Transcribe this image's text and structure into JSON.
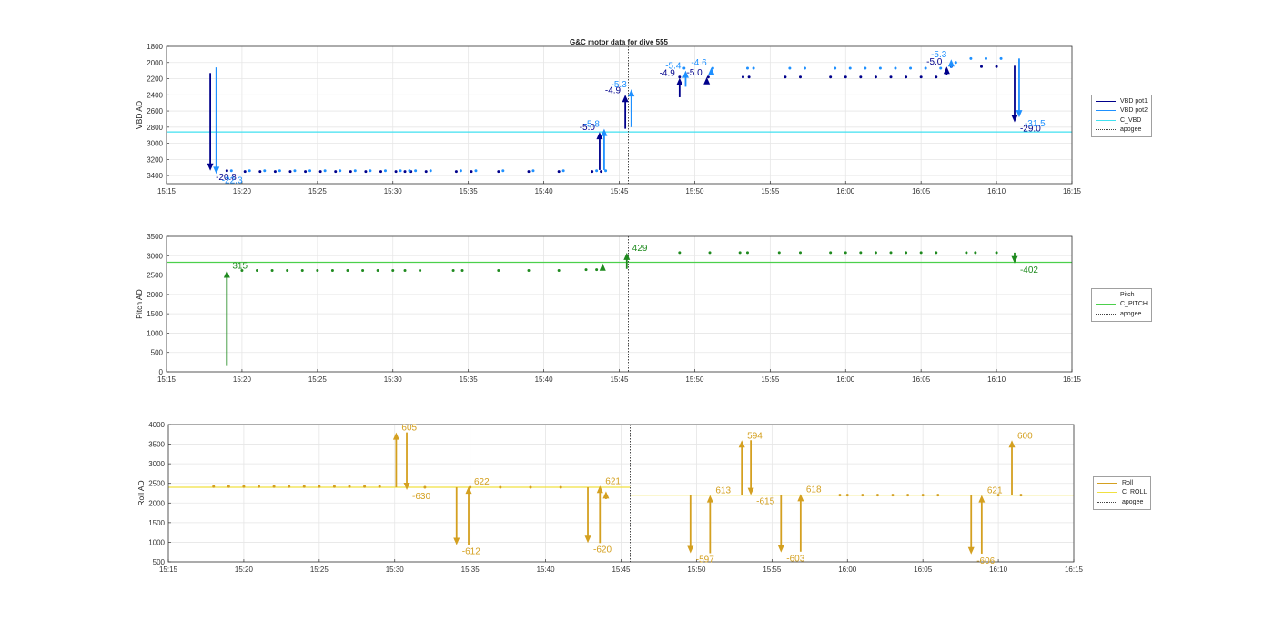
{
  "figure_title": "G&C motor data for dive 555",
  "chart_data": [
    {
      "type": "scatter",
      "title": "G&C motor data for dive 555",
      "xlabel": "",
      "ylabel": "VBD AD",
      "x_ticks": [
        "15:15",
        "15:20",
        "15:25",
        "15:30",
        "15:35",
        "15:40",
        "15:45",
        "15:50",
        "15:55",
        "16:00",
        "16:05",
        "16:10",
        "16:15"
      ],
      "x_range": [
        "15:15",
        "16:15"
      ],
      "ylim": [
        1800,
        3500
      ],
      "y_reversed": true,
      "y_ticks": [
        1800,
        2000,
        2200,
        2400,
        2600,
        2800,
        3000,
        3200,
        3400
      ],
      "grid": true,
      "legend": [
        {
          "label": "VBD pot1",
          "color": "#00008b",
          "style": "solid"
        },
        {
          "label": "VBD pot2",
          "color": "#1e90ff",
          "style": "solid"
        },
        {
          "label": "C_VBD",
          "color": "#40e0f0",
          "style": "solid"
        },
        {
          "label": "apogee",
          "color": "#444444",
          "style": "dotted"
        }
      ],
      "legend_placement": "outside-right",
      "reference_lines": [
        {
          "name": "C_VBD",
          "y": 2860,
          "color": "#40e0f0"
        }
      ],
      "apogee_time": "15:45.6",
      "series": [
        {
          "name": "VBD pot1",
          "color": "#00008b",
          "x": [
            "15:19.0",
            "15:20.2",
            "15:21.2",
            "15:22.2",
            "15:23.2",
            "15:24.2",
            "15:25.2",
            "15:26.2",
            "15:27.2",
            "15:28.2",
            "15:29.2",
            "15:30.2",
            "15:30.8",
            "15:31.2",
            "15:32.2",
            "15:34.2",
            "15:35.2",
            "15:37.0",
            "15:39.0",
            "15:41.0",
            "15:43.2",
            "15:43.8",
            "15:49.0",
            "15:50.9",
            "15:53.2",
            "15:53.6",
            "15:56.0",
            "15:57.0",
            "15:59.0",
            "16:00.0",
            "16:01.0",
            "16:02.0",
            "16:03.0",
            "16:04.0",
            "16:05.0",
            "16:06.0",
            "16:07.0",
            "16:09.0",
            "16:10.0"
          ],
          "y": [
            3340,
            3350,
            3350,
            3350,
            3350,
            3350,
            3350,
            3350,
            3350,
            3350,
            3350,
            3350,
            3350,
            3350,
            3350,
            3350,
            3350,
            3350,
            3350,
            3350,
            3350,
            3350,
            2180,
            2180,
            2180,
            2180,
            2180,
            2180,
            2180,
            2180,
            2180,
            2180,
            2180,
            2180,
            2180,
            2180,
            2050,
            2050,
            2050
          ]
        },
        {
          "name": "VBD pot2",
          "color": "#1e90ff",
          "x": [
            "15:19.3",
            "15:20.5",
            "15:21.5",
            "15:22.5",
            "15:23.5",
            "15:24.5",
            "15:25.5",
            "15:26.5",
            "15:27.5",
            "15:28.5",
            "15:29.5",
            "15:30.5",
            "15:31.1",
            "15:31.5",
            "15:32.5",
            "15:34.5",
            "15:35.5",
            "15:37.3",
            "15:39.3",
            "15:41.3",
            "15:43.5",
            "15:44.1",
            "15:49.3",
            "15:51.2",
            "15:53.5",
            "15:53.9",
            "15:56.3",
            "15:57.3",
            "15:59.3",
            "16:00.3",
            "16:01.3",
            "16:02.3",
            "16:03.3",
            "16:04.3",
            "16:05.3",
            "16:06.3",
            "16:07.3",
            "16:08.3",
            "16:09.3",
            "16:10.3"
          ],
          "y": [
            3340,
            3340,
            3340,
            3340,
            3340,
            3340,
            3340,
            3340,
            3340,
            3340,
            3340,
            3340,
            3340,
            3340,
            3340,
            3340,
            3340,
            3340,
            3340,
            3340,
            3340,
            3340,
            2070,
            2070,
            2070,
            2070,
            2070,
            2070,
            2070,
            2070,
            2070,
            2070,
            2070,
            2070,
            2070,
            2070,
            2000,
            1950,
            1950,
            1950
          ]
        }
      ],
      "events": [
        {
          "x": "15:17.9",
          "y_from": 2130,
          "y_to": 3340,
          "label": "-20.8",
          "color": "#00008b"
        },
        {
          "x": "15:18.3",
          "y_from": 2060,
          "y_to": 3380,
          "label": "-22.3",
          "color": "#1e90ff"
        },
        {
          "x": "15:43.7",
          "y_from": 3330,
          "y_to": 2860,
          "label": "-5.0",
          "color": "#00008b"
        },
        {
          "x": "15:44.0",
          "y_from": 3330,
          "y_to": 2820,
          "label": "-5.8",
          "color": "#1e90ff"
        },
        {
          "x": "15:45.4",
          "y_from": 2820,
          "y_to": 2400,
          "label": "-4.9",
          "color": "#00008b"
        },
        {
          "x": "15:45.8",
          "y_from": 2800,
          "y_to": 2330,
          "label": "-5.3",
          "color": "#1e90ff"
        },
        {
          "x": "15:49.0",
          "y_from": 2430,
          "y_to": 2190,
          "label": "-4.9",
          "color": "#00008b"
        },
        {
          "x": "15:49.4",
          "y_from": 2300,
          "y_to": 2100,
          "label": "-5.4",
          "color": "#1e90ff"
        },
        {
          "x": "15:50.8",
          "y_from": 2240,
          "y_to": 2180,
          "label": "-5.0",
          "color": "#00008b"
        },
        {
          "x": "15:51.1",
          "y_from": 2140,
          "y_to": 2060,
          "label": "-4.6",
          "color": "#1e90ff"
        },
        {
          "x": "16:06.7",
          "y_from": 2160,
          "y_to": 2050,
          "label": "-5.0",
          "color": "#00008b"
        },
        {
          "x": "16:07.0",
          "y_from": 2070,
          "y_to": 1960,
          "label": "-5.3",
          "color": "#1e90ff"
        },
        {
          "x": "16:11.2",
          "y_from": 2040,
          "y_to": 2740,
          "label": "-29.0",
          "color": "#00008b"
        },
        {
          "x": "16:11.5",
          "y_from": 1950,
          "y_to": 2680,
          "label": "-31.5",
          "color": "#1e90ff"
        }
      ]
    },
    {
      "type": "scatter",
      "title": "",
      "xlabel": "",
      "ylabel": "Pitch AD",
      "x_ticks": [
        "15:15",
        "15:20",
        "15:25",
        "15:30",
        "15:35",
        "15:40",
        "15:45",
        "15:50",
        "15:55",
        "16:00",
        "16:05",
        "16:10",
        "16:15"
      ],
      "x_range": [
        "15:15",
        "16:15"
      ],
      "ylim": [
        0,
        3500
      ],
      "y_reversed": false,
      "y_ticks": [
        0,
        500,
        1000,
        1500,
        2000,
        2500,
        3000,
        3500
      ],
      "grid": true,
      "legend": [
        {
          "label": "Pitch",
          "color": "#1f8a1f",
          "style": "solid"
        },
        {
          "label": "C_PITCH",
          "color": "#4cd04c",
          "style": "solid"
        },
        {
          "label": "apogee",
          "color": "#444444",
          "style": "dotted"
        }
      ],
      "legend_placement": "outside-right",
      "reference_lines": [
        {
          "name": "C_PITCH",
          "y": 2830,
          "color": "#4cd04c"
        }
      ],
      "apogee_time": "15:45.6",
      "series": [
        {
          "name": "Pitch",
          "color": "#1f8a1f",
          "x": [
            "15:20.0",
            "15:21.0",
            "15:22.0",
            "15:23.0",
            "15:24.0",
            "15:25.0",
            "15:26.0",
            "15:27.0",
            "15:28.0",
            "15:29.0",
            "15:30.0",
            "15:30.8",
            "15:31.8",
            "15:34.0",
            "15:34.6",
            "15:37.0",
            "15:39.0",
            "15:41.0",
            "15:42.8",
            "15:43.5",
            "15:49.0",
            "15:51.0",
            "15:53.0",
            "15:53.5",
            "15:55.6",
            "15:57.0",
            "15:59.0",
            "16:00.0",
            "16:01.0",
            "16:02.0",
            "16:03.0",
            "16:04.0",
            "16:05.0",
            "16:06.0",
            "16:08.0",
            "16:08.6",
            "16:10.0"
          ],
          "y": [
            2620,
            2620,
            2620,
            2620,
            2620,
            2620,
            2620,
            2620,
            2620,
            2620,
            2620,
            2620,
            2620,
            2620,
            2620,
            2620,
            2620,
            2620,
            2640,
            2640,
            3080,
            3080,
            3080,
            3080,
            3080,
            3080,
            3080,
            3080,
            3080,
            3080,
            3080,
            3080,
            3080,
            3080,
            3080,
            3080,
            3080
          ]
        }
      ],
      "events": [
        {
          "x": "15:19.0",
          "y_from": 150,
          "y_to": 2620,
          "label": "315",
          "color": "#1f8a1f"
        },
        {
          "x": "15:43.9",
          "y_from": 2640,
          "y_to": 2800,
          "label": "",
          "color": "#1f8a1f"
        },
        {
          "x": "15:45.5",
          "y_from": 2660,
          "y_to": 3080,
          "label": "429",
          "color": "#1f8a1f"
        },
        {
          "x": "16:11.2",
          "y_from": 3080,
          "y_to": 2800,
          "label": "-402",
          "color": "#1f8a1f"
        }
      ]
    },
    {
      "type": "scatter",
      "title": "",
      "xlabel": "",
      "ylabel": "Roll AD",
      "x_ticks": [
        "15:15",
        "15:20",
        "15:25",
        "15:30",
        "15:35",
        "15:40",
        "15:45",
        "15:50",
        "15:55",
        "16:00",
        "16:05",
        "16:10",
        "16:15"
      ],
      "x_range": [
        "15:15",
        "16:15"
      ],
      "ylim": [
        500,
        4000
      ],
      "y_reversed": false,
      "y_ticks": [
        500,
        1000,
        1500,
        2000,
        2500,
        3000,
        3500,
        4000
      ],
      "grid": true,
      "legend": [
        {
          "label": "Roll",
          "color": "#d4a020",
          "style": "solid"
        },
        {
          "label": "C_ROLL",
          "color": "#f0e040",
          "style": "solid"
        },
        {
          "label": "apogee",
          "color": "#444444",
          "style": "dotted"
        }
      ],
      "legend_placement": "outside-right",
      "reference_lines": [
        {
          "name": "C_ROLL",
          "x_range": [
            "15:15",
            "15:45.6"
          ],
          "y": 2400,
          "color": "#f0e040"
        },
        {
          "name": "C_ROLL",
          "x_range": [
            "15:45.6",
            "16:15"
          ],
          "y": 2200,
          "color": "#f0e040"
        }
      ],
      "apogee_time": "15:45.6",
      "series": [
        {
          "name": "Roll",
          "color": "#d4a020",
          "x": [
            "15:18.0",
            "15:19.0",
            "15:20.0",
            "15:21.0",
            "15:22.0",
            "15:23.0",
            "15:24.0",
            "15:25.0",
            "15:26.0",
            "15:27.0",
            "15:28.0",
            "15:29.0",
            "15:32.0",
            "15:35.0",
            "15:37.0",
            "15:39.0",
            "15:41.0",
            "15:59.5",
            "16:00.0",
            "16:01.0",
            "16:02.0",
            "16:03.0",
            "16:04.0",
            "16:05.0",
            "16:06.0",
            "16:10.0",
            "16:11.5"
          ],
          "y": [
            2420,
            2420,
            2420,
            2420,
            2420,
            2420,
            2420,
            2420,
            2420,
            2420,
            2420,
            2420,
            2400,
            2400,
            2400,
            2400,
            2400,
            2200,
            2200,
            2200,
            2200,
            2200,
            2200,
            2200,
            2200,
            2200,
            2200
          ]
        }
      ],
      "events": [
        {
          "x": "15:30.1",
          "y_from": 2400,
          "y_to": 3800,
          "label": "605",
          "color": "#d4a020"
        },
        {
          "x": "15:30.8",
          "y_from": 3800,
          "y_to": 2330,
          "label": "-630",
          "color": "#d4a020"
        },
        {
          "x": "15:34.1",
          "y_from": 2400,
          "y_to": 930,
          "label": "-612",
          "color": "#d4a020"
        },
        {
          "x": "15:34.9",
          "y_from": 930,
          "y_to": 2420,
          "label": "622",
          "color": "#d4a020"
        },
        {
          "x": "15:42.8",
          "y_from": 2400,
          "y_to": 980,
          "label": "-620",
          "color": "#d4a020"
        },
        {
          "x": "15:43.6",
          "y_from": 980,
          "y_to": 2440,
          "label": "621",
          "color": "#d4a020"
        },
        {
          "x": "15:44.0",
          "y_from": 2100,
          "y_to": 2300,
          "label": "",
          "color": "#d4a020"
        },
        {
          "x": "15:49.6",
          "y_from": 2200,
          "y_to": 720,
          "label": "-597",
          "color": "#d4a020"
        },
        {
          "x": "15:50.9",
          "y_from": 720,
          "y_to": 2200,
          "label": "613",
          "color": "#d4a020"
        },
        {
          "x": "15:53.0",
          "y_from": 2200,
          "y_to": 3600,
          "label": "594",
          "color": "#d4a020"
        },
        {
          "x": "15:53.6",
          "y_from": 3600,
          "y_to": 2200,
          "label": "-615",
          "color": "#d4a020"
        },
        {
          "x": "15:55.6",
          "y_from": 2200,
          "y_to": 740,
          "label": "-603",
          "color": "#d4a020"
        },
        {
          "x": "15:56.9",
          "y_from": 760,
          "y_to": 2230,
          "label": "618",
          "color": "#d4a020"
        },
        {
          "x": "16:08.2",
          "y_from": 2200,
          "y_to": 690,
          "label": "-606",
          "color": "#d4a020"
        },
        {
          "x": "16:08.9",
          "y_from": 710,
          "y_to": 2200,
          "label": "621",
          "color": "#d4a020"
        },
        {
          "x": "16:10.9",
          "y_from": 2200,
          "y_to": 3600,
          "label": "600",
          "color": "#d4a020"
        }
      ]
    }
  ]
}
